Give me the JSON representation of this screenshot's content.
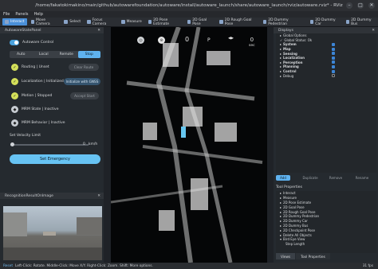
{
  "window": {
    "title": "/home/fakatokimakino/main/github/autowarefoundation/autoware/install/autoware_launch/share/autoware_launch/rviz/autoware.rviz* - RViz",
    "minimize": "–",
    "maximize": "□",
    "close": "✕"
  },
  "menu": [
    "File",
    "Panels",
    "Help"
  ],
  "toolbar": [
    "Interact",
    "Move Camera",
    "Select",
    "Focus Camera",
    "Measure",
    "2D Pose Estimate",
    "2D Goal Pose",
    "2D Rough Goal Pose",
    "2D Dummy Pedestrian",
    "2D Dummy Car",
    "2D Dummy Bus"
  ],
  "state_panel": {
    "title": "AutowareStatePanel",
    "autoware_control": "Autoware Control",
    "modes": [
      "Auto",
      "Local",
      "Remote",
      "Stop"
    ],
    "rows": [
      {
        "label": "Routing | Unset",
        "button": "Clear Route",
        "status": "ok"
      },
      {
        "label": "Localization | Initialized",
        "button": "Initialize with GNSS",
        "status": "ok"
      },
      {
        "label": "Motion | Stopped",
        "button": "Accept Start",
        "status": "ok"
      },
      {
        "label": "MRM State | Inactive",
        "status": "info"
      },
      {
        "label": "MRM Behavior | Inactive",
        "status": "info"
      }
    ],
    "velocity_label": "Set Velocity Limit",
    "velocity_value": "0",
    "velocity_unit": "km/h",
    "emergency": "Set Emergency"
  },
  "camera_panel": {
    "title": "RecognitionResultOnImage"
  },
  "osd": {
    "speed_value": "0",
    "gear": "P",
    "signal_value": "0",
    "signal_unit": "sec"
  },
  "displays": {
    "title": "Displays",
    "items": [
      {
        "label": "Global Options",
        "bold": false,
        "checked": false
      },
      {
        "label": "Global Status: Ok",
        "bold": false,
        "checked": false
      },
      {
        "label": "System",
        "bold": true,
        "checked": true
      },
      {
        "label": "Map",
        "bold": true,
        "checked": true
      },
      {
        "label": "Sensing",
        "bold": true,
        "checked": true
      },
      {
        "label": "Localization",
        "bold": true,
        "checked": true
      },
      {
        "label": "Perception",
        "bold": true,
        "checked": true
      },
      {
        "label": "Planning",
        "bold": true,
        "checked": true
      },
      {
        "label": "Control",
        "bold": true,
        "checked": true
      },
      {
        "label": "Debug",
        "bold": false,
        "checked": false
      }
    ],
    "buttons": [
      "Add",
      "Duplicate",
      "Remove",
      "Rename"
    ]
  },
  "tool_properties": {
    "title": "Tool Properties",
    "items": [
      "Interact",
      "Measure",
      "2D Pose Estimate",
      "2D Goal Pose",
      "2D Rough Goal Pose",
      "2D Dummy Pedestrian",
      "2D Dummy Car",
      "2D Dummy Bus",
      "2D Checkpoint Pose",
      "Delete All Objects",
      "Bird Eye View"
    ],
    "step_length": "Step Length"
  },
  "view_tabs": [
    "Views",
    "Tool Properties"
  ],
  "status": {
    "reset": "Reset",
    "text": "Left-Click: Rotate. Middle-Click: Move X/Y. Right-Click: Zoom. Shift: More options.",
    "fps": "31 fps"
  },
  "colors": {
    "accent": "#4a90d9",
    "toggle": "#4aa3df",
    "mode_selected": "#5fb2ef",
    "emergency": "#67c3f3",
    "ok": "#d4e05a"
  }
}
